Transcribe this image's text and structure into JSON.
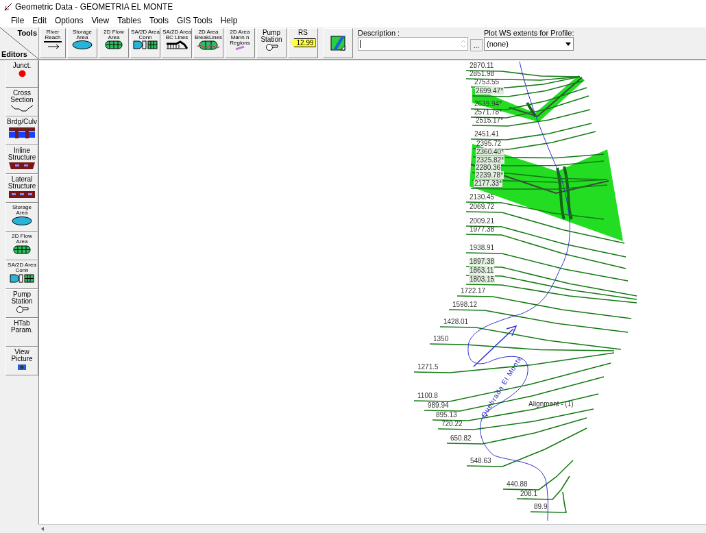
{
  "window": {
    "title": "Geometric Data - GEOMETRIA EL MONTE"
  },
  "menu": [
    "File",
    "Edit",
    "Options",
    "View",
    "Tables",
    "Tools",
    "GIS Tools",
    "Help"
  ],
  "corner": {
    "tools": "Tools",
    "editors": "Editors"
  },
  "toolbar": [
    {
      "kind": "reach",
      "label": "River\nReach"
    },
    {
      "kind": "storage",
      "label": "Storage\nArea"
    },
    {
      "kind": "flow2d",
      "label": "2D Flow\nArea"
    },
    {
      "kind": "conn",
      "label": "SA/2D Area\nConn"
    },
    {
      "kind": "bc",
      "label": "SA/2D Area\nBC Lines"
    },
    {
      "kind": "breaklines",
      "label": "2D Area\nBreakLines"
    },
    {
      "kind": "mann",
      "label": "2D Area\nMann n\nRegions"
    },
    {
      "kind": "pump",
      "label": "Pump\nStation"
    },
    {
      "kind": "rs",
      "label": "RS",
      "tag": "12.99"
    },
    {
      "kind": "map"
    }
  ],
  "description": {
    "label": "Description :"
  },
  "browse_button": "...",
  "profile": {
    "label": "Plot WS extents for Profile:",
    "value": "(none)"
  },
  "editors": [
    {
      "kind": "junct",
      "label": "Junct."
    },
    {
      "kind": "xs",
      "label": "Cross\nSection"
    },
    {
      "kind": "bridge",
      "label": "Brdg/Culv"
    },
    {
      "kind": "inline",
      "label": "Inline\nStructure"
    },
    {
      "kind": "lateral",
      "label": "Lateral\nStructure"
    },
    {
      "kind": "storage",
      "label": "Storage\nArea"
    },
    {
      "kind": "flow2d",
      "label": "2D Flow\nArea"
    },
    {
      "kind": "conn",
      "label": "SA/2D Area\nConn"
    },
    {
      "kind": "pump",
      "label": "Pump\nStation"
    },
    {
      "kind": "none",
      "label": "HTab\nParam."
    },
    {
      "kind": "picture",
      "label": "View\nPicture"
    }
  ],
  "map": {
    "river_name": "Quebrada El Monte",
    "alignment_label": "Alignment - (1)",
    "cross_sections": [
      {
        "label": "2870.11",
        "highlighted": false
      },
      {
        "label": "2851.98",
        "highlighted": false
      },
      {
        "label": "2753.55",
        "highlighted": false
      },
      {
        "label": "2699.47*",
        "highlighted": true
      },
      {
        "label": "2639.94*",
        "highlighted": false
      },
      {
        "label": "2571.78*",
        "highlighted": false
      },
      {
        "label": "2515.17*",
        "highlighted": false
      },
      {
        "label": "2451.41",
        "highlighted": false
      },
      {
        "label": "2395.72",
        "highlighted": false
      },
      {
        "label": "2360.40*",
        "highlighted": true
      },
      {
        "label": "2325.82*",
        "highlighted": true
      },
      {
        "label": "2280.36",
        "highlighted": true
      },
      {
        "label": "2239.78*",
        "highlighted": true
      },
      {
        "label": "2177.33*",
        "highlighted": true
      },
      {
        "label": "2130.45",
        "highlighted": false
      },
      {
        "label": "2069.72",
        "highlighted": false
      },
      {
        "label": "2009.21",
        "highlighted": false
      },
      {
        "label": "1977.38",
        "highlighted": false
      },
      {
        "label": "1938.91",
        "highlighted": false
      },
      {
        "label": "1897.38",
        "highlighted": true
      },
      {
        "label": "1863.11",
        "highlighted": true
      },
      {
        "label": "1803.15",
        "highlighted": true
      },
      {
        "label": "1722.17",
        "highlighted": false
      },
      {
        "label": "1598.12",
        "highlighted": false
      },
      {
        "label": "1428.01",
        "highlighted": false
      },
      {
        "label": "1350",
        "highlighted": false
      },
      {
        "label": "1271.5",
        "highlighted": false
      },
      {
        "label": "1100.8",
        "highlighted": false
      },
      {
        "label": "989.94",
        "highlighted": false
      },
      {
        "label": "895.13",
        "highlighted": false
      },
      {
        "label": "720.22",
        "highlighted": false
      },
      {
        "label": "650.82",
        "highlighted": false
      },
      {
        "label": "548.63",
        "highlighted": false
      },
      {
        "label": "440.88",
        "highlighted": false
      },
      {
        "label": "208.1",
        "highlighted": false
      },
      {
        "label": "89.9",
        "highlighted": false
      }
    ]
  }
}
